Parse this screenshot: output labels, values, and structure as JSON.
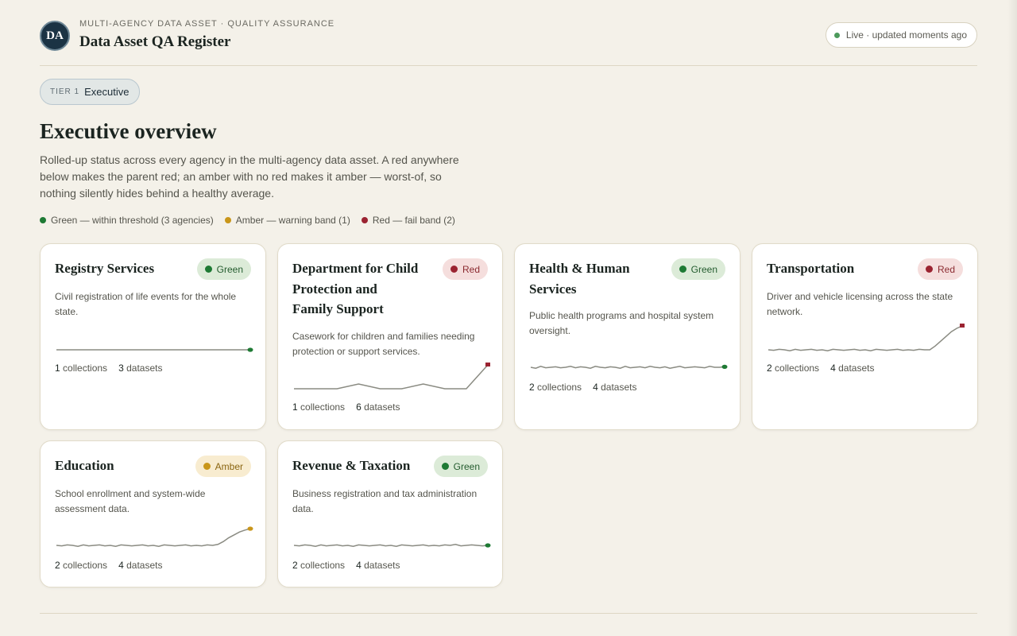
{
  "header": {
    "logo_text": "DA",
    "kicker": "MULTI-AGENCY DATA ASSET · QUALITY ASSURANCE",
    "title": "Data Asset QA Register",
    "live_text": "Live · updated moments ago"
  },
  "tier": {
    "label": "TIER 1",
    "name": "Executive"
  },
  "overview": {
    "title": "Executive overview",
    "description": "Rolled-up status across every agency in the multi-agency data asset. A red anywhere below makes the parent red; an amber with no red makes it amber — worst-of, so nothing silently hides behind a healthy average."
  },
  "legend": [
    {
      "text": "Green — within threshold (3 agencies)",
      "color": "#1e7a34"
    },
    {
      "text": "Amber — warning band (1)",
      "color": "#c9961a"
    },
    {
      "text": "Red — fail band (2)",
      "color": "#9b2331"
    }
  ],
  "status_colors": {
    "green": "#1e7a34",
    "amber": "#c9961a",
    "red": "#9b2331",
    "trend_line": "#8a8b82"
  },
  "agencies": [
    {
      "name": "Registry Services",
      "status": "Green",
      "description": "Civil registration of life events for the whole state.",
      "collections": "1",
      "collections_label": "collections",
      "datasets": "3",
      "datasets_label": "datasets",
      "trend": [
        0.5,
        0.5,
        0.5,
        0.5,
        0.5,
        0.5,
        0.5,
        0.5,
        0.5,
        0.5
      ]
    },
    {
      "name": "Department for Child Protection and Family Support",
      "status": "Red",
      "description": "Casework for children and families needing protection or support services.",
      "collections": "1",
      "collections_label": "collections",
      "datasets": "6",
      "datasets_label": "datasets",
      "trend": [
        0.5,
        0.5,
        0.5,
        0.6,
        0.5,
        0.5,
        0.6,
        0.5,
        0.5,
        1.0
      ]
    },
    {
      "name": "Health & Human Services",
      "status": "Green",
      "description": "Public health programs and hospital system oversight.",
      "collections": "2",
      "collections_label": "collections",
      "datasets": "4",
      "datasets_label": "datasets",
      "trend": [
        0.5,
        0.48,
        0.52,
        0.49,
        0.5,
        0.51,
        0.49,
        0.5,
        0.52,
        0.49,
        0.51,
        0.5,
        0.48,
        0.52,
        0.5,
        0.49,
        0.51,
        0.5,
        0.48,
        0.52,
        0.49,
        0.5,
        0.51,
        0.49,
        0.52,
        0.5,
        0.49,
        0.51,
        0.48,
        0.5,
        0.52,
        0.49,
        0.5,
        0.51,
        0.5,
        0.49,
        0.52,
        0.5,
        0.5,
        0.51
      ]
    },
    {
      "name": "Transportation",
      "status": "Red",
      "description": "Driver and vehicle licensing across the state network.",
      "collections": "2",
      "collections_label": "collections",
      "datasets": "4",
      "datasets_label": "datasets",
      "trend": [
        0.5,
        0.49,
        0.51,
        0.5,
        0.48,
        0.51,
        0.49,
        0.5,
        0.51,
        0.49,
        0.5,
        0.48,
        0.51,
        0.5,
        0.49,
        0.5,
        0.51,
        0.49,
        0.5,
        0.48,
        0.51,
        0.5,
        0.49,
        0.5,
        0.51,
        0.49,
        0.5,
        0.49,
        0.51,
        0.5,
        0.5,
        0.58,
        0.68,
        0.78,
        0.88,
        0.95,
        1.0
      ]
    },
    {
      "name": "Education",
      "status": "Amber",
      "description": "School enrollment and system-wide assessment data.",
      "collections": "2",
      "collections_label": "collections",
      "datasets": "4",
      "datasets_label": "datasets",
      "trend": [
        0.5,
        0.49,
        0.51,
        0.5,
        0.48,
        0.51,
        0.49,
        0.5,
        0.51,
        0.49,
        0.5,
        0.48,
        0.51,
        0.5,
        0.49,
        0.5,
        0.51,
        0.49,
        0.5,
        0.48,
        0.51,
        0.5,
        0.49,
        0.5,
        0.51,
        0.49,
        0.5,
        0.49,
        0.51,
        0.5,
        0.52,
        0.58,
        0.66,
        0.72,
        0.78,
        0.82,
        0.85
      ]
    },
    {
      "name": "Revenue & Taxation",
      "status": "Green",
      "description": "Business registration and tax administration data.",
      "collections": "2",
      "collections_label": "collections",
      "datasets": "4",
      "datasets_label": "datasets",
      "trend": [
        0.5,
        0.49,
        0.51,
        0.5,
        0.48,
        0.51,
        0.49,
        0.5,
        0.51,
        0.49,
        0.5,
        0.48,
        0.51,
        0.5,
        0.49,
        0.5,
        0.51,
        0.49,
        0.5,
        0.48,
        0.51,
        0.5,
        0.49,
        0.5,
        0.51,
        0.49,
        0.5,
        0.49,
        0.51,
        0.5,
        0.52,
        0.49,
        0.5,
        0.51,
        0.5,
        0.49,
        0.5
      ]
    }
  ]
}
